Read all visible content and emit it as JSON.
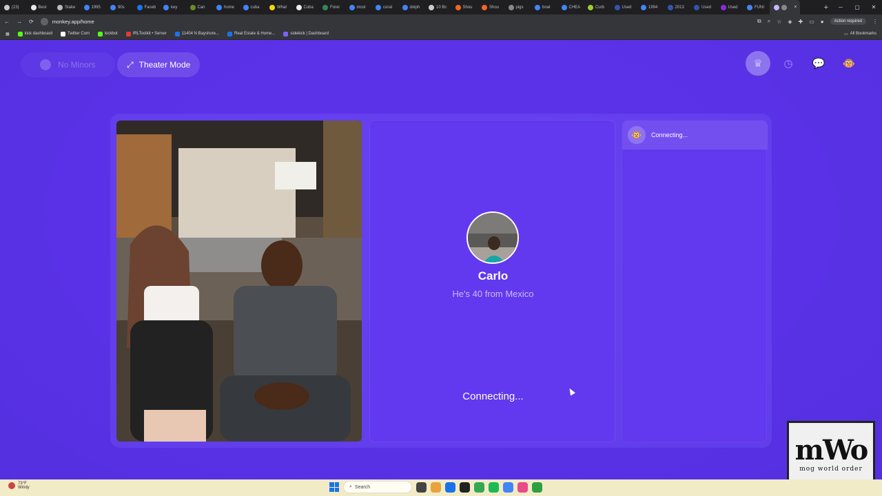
{
  "browser": {
    "tabs": [
      {
        "label": "(23)",
        "color": "#cccccc"
      },
      {
        "label": "Best",
        "color": "#e8e8e8"
      },
      {
        "label": "Stake",
        "color": "#bbbbbb"
      },
      {
        "label": "1995",
        "color": "#4285f4"
      },
      {
        "label": "90s",
        "color": "#4285f4"
      },
      {
        "label": "Faceb",
        "color": "#1877f2"
      },
      {
        "label": "key",
        "color": "#4285f4"
      },
      {
        "label": "Can",
        "color": "#6b8e23"
      },
      {
        "label": "home",
        "color": "#4285f4"
      },
      {
        "label": "cuba",
        "color": "#4285f4"
      },
      {
        "label": "What",
        "color": "#f5d90a"
      },
      {
        "label": "Cuba",
        "color": "#eeeeee"
      },
      {
        "label": "Forei",
        "color": "#2e8b57"
      },
      {
        "label": "most",
        "color": "#4285f4"
      },
      {
        "label": "coral",
        "color": "#4285f4"
      },
      {
        "label": "dolph",
        "color": "#4285f4"
      },
      {
        "label": "10 Bc",
        "color": "#cccccc"
      },
      {
        "label": "Shou",
        "color": "#f26522"
      },
      {
        "label": "Shou",
        "color": "#f26522"
      },
      {
        "label": "pigs",
        "color": "#888888"
      },
      {
        "label": "boat",
        "color": "#4285f4"
      },
      {
        "label": "CHEA",
        "color": "#4285f4"
      },
      {
        "label": "Curb",
        "color": "#9acd32"
      },
      {
        "label": "Used",
        "color": "#3355aa"
      },
      {
        "label": "1994",
        "color": "#4285f4"
      },
      {
        "label": "2013",
        "color": "#3355aa"
      },
      {
        "label": "Used",
        "color": "#3355aa"
      },
      {
        "label": "Used",
        "color": "#8a2be2"
      },
      {
        "label": "FUNI",
        "color": "#4285f4"
      }
    ],
    "active_tab_close": "×",
    "new_tab": "+",
    "url": "monkey.app/home",
    "action_required": "Action required",
    "bookmarks": [
      {
        "label": "kick dashboard",
        "color": "#53fc18"
      },
      {
        "label": "Twitter Com",
        "color": "#ffffff"
      },
      {
        "label": "kickbot",
        "color": "#53fc18"
      },
      {
        "label": "IRLToolkit • Server",
        "color": "#e53935"
      },
      {
        "label": "11404 N Bayshore...",
        "color": "#1a73e8"
      },
      {
        "label": "Real Estate & Home...",
        "color": "#1a73e8"
      },
      {
        "label": "sidekick | Dashboard",
        "color": "#7b61ff"
      }
    ],
    "all_bookmarks": "All Bookmarks"
  },
  "app": {
    "no_minors": "No Minors",
    "theater_mode": "Theater Mode",
    "top_icons": [
      "crown-icon",
      "history-icon",
      "chat-icon",
      "monkey-avatar-icon"
    ],
    "profile": {
      "name": "Carlo",
      "subtitle": "He's 40 from Mexico",
      "status": "Connecting..."
    },
    "chat": {
      "status": "Connecting..."
    }
  },
  "watermark": {
    "big": "mWo",
    "small": "mog world order"
  },
  "taskbar": {
    "weather_temp": "73°F",
    "weather_desc": "Windy",
    "search_placeholder": "Search"
  },
  "colors": {
    "page_bg": "#5a31e6",
    "card_bg": "#6239ee",
    "accent": "#8c74ee"
  }
}
